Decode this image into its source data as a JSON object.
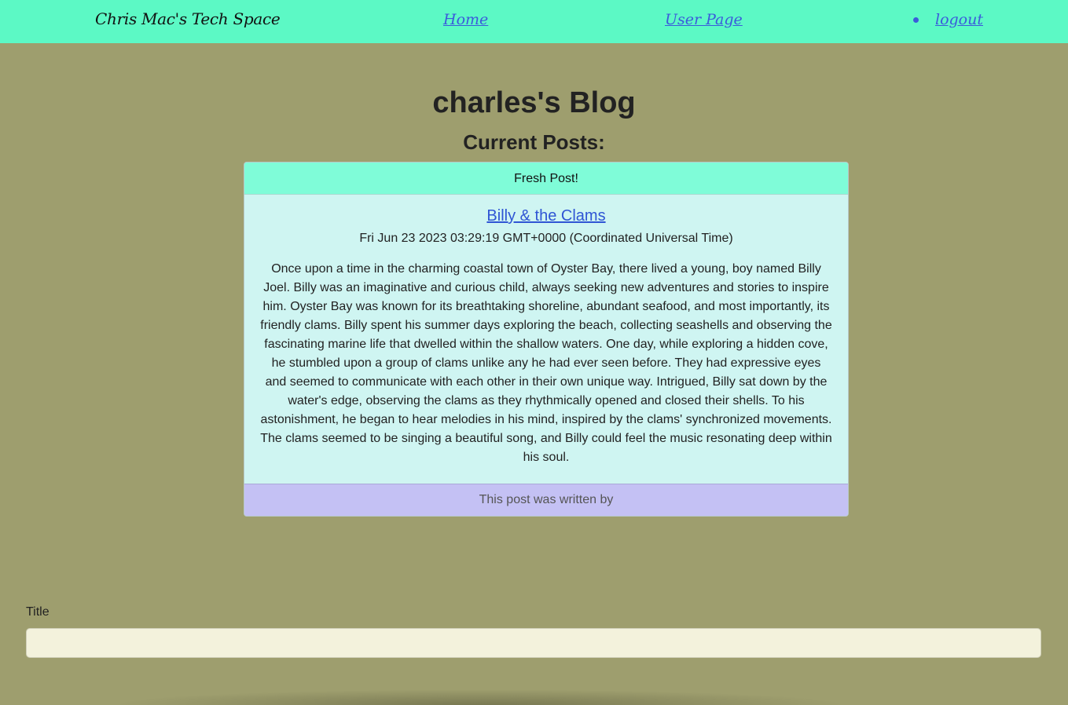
{
  "navbar": {
    "brand": "Chris Mac's Tech Space",
    "links": [
      {
        "label": "Home"
      },
      {
        "label": "User Page"
      },
      {
        "label": "logout"
      }
    ]
  },
  "page": {
    "title": "charles's Blog",
    "subtitle": "Current Posts:"
  },
  "post": {
    "header": "Fresh Post!",
    "title": "Billy & the Clams",
    "date": "Fri Jun 23 2023 03:29:19 GMT+0000 (Coordinated Universal Time)",
    "body": "Once upon a time in the charming coastal town of Oyster Bay, there lived a young, boy named Billy Joel. Billy was an imaginative and curious child, always seeking new adventures and stories to inspire him. Oyster Bay was known for its breathtaking shoreline, abundant seafood, and most importantly, its friendly clams. Billy spent his summer days exploring the beach, collecting seashells and observing the fascinating marine life that dwelled within the shallow waters. One day, while exploring a hidden cove, he stumbled upon a group of clams unlike any he had ever seen before. They had expressive eyes and seemed to communicate with each other in their own unique way. Intrigued, Billy sat down by the water's edge, observing the clams as they rhythmically opened and closed their shells. To his astonishment, he began to hear melodies in his mind, inspired by the clams' synchronized movements. The clams seemed to be singing a beautiful song, and Billy could feel the music resonating deep within his soul.",
    "footer": "This post was written by"
  },
  "form": {
    "title_label": "Title",
    "title_value": ""
  },
  "colors": {
    "navbar": "#5cf9c5",
    "background": "#9e9e6e",
    "card_header": "#7ffcd8",
    "card_body": "#cff5f2",
    "card_footer": "#c4c1f4",
    "link": "#3b5bdb"
  }
}
